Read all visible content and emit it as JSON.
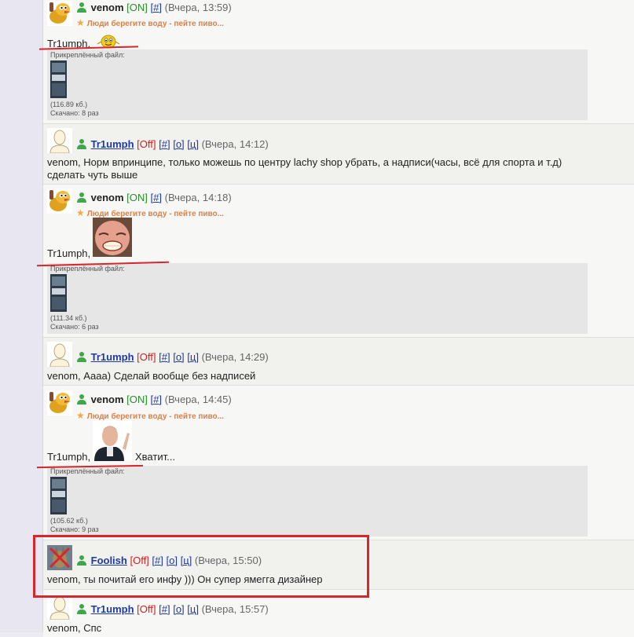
{
  "posts": [
    {
      "user": "venom",
      "status": "[ON]",
      "links": [
        "[#]"
      ],
      "date": "(Вчера, 13:59)",
      "signature": "Люди берегите воду - пейте пиво...",
      "message": "Tr1umph,",
      "attachment": {
        "label": "Прикреплённый файл:",
        "size": "(116.89 кб.)",
        "downloads": "Скачано: 8 раз"
      }
    },
    {
      "user": "Tr1umph",
      "status": "[Off]",
      "links": [
        "[#]",
        "[о]",
        "[ц]"
      ],
      "date": "(Вчера, 14:12)",
      "message_line1": "venom, Норм впринципе, только можешь по центру lachy shop убрать, а надписи(часы, всё для спорта и т.д)",
      "message_line2": "сделать чуть выше"
    },
    {
      "user": "venom",
      "status": "[ON]",
      "links": [
        "[#]"
      ],
      "date": "(Вчера, 14:18)",
      "signature": "Люди берегите воду - пейте пиво...",
      "message": "Tr1umph,",
      "attachment": {
        "label": "Прикреплённый файл:",
        "size": "(111.34 кб.)",
        "downloads": "Скачано: 6 раз"
      }
    },
    {
      "user": "Tr1umph",
      "status": "[Off]",
      "links": [
        "[#]",
        "[о]",
        "[ц]"
      ],
      "date": "(Вчера, 14:29)",
      "message": "venom, Аааа) Сделай вообще без надписей"
    },
    {
      "user": "venom",
      "status": "[ON]",
      "links": [
        "[#]"
      ],
      "date": "(Вчера, 14:45)",
      "signature": "Люди берегите воду - пейте пиво...",
      "message": "Tr1umph,",
      "message_after": "Хватит...",
      "attachment": {
        "label": "Прикреплённый файл:",
        "size": "(105.62 кб.)",
        "downloads": "Скачано: 9 раз"
      }
    },
    {
      "user": "Foolish",
      "status": "[Off]",
      "links": [
        "[#]",
        "[о]",
        "[ц]"
      ],
      "date": "(Вчера, 15:50)",
      "message": "venom, ты почитай его инфу ))) Он супер ямегга дизайнер"
    },
    {
      "user": "Tr1umph",
      "status": "[Off]",
      "links": [
        "[#]",
        "[о]",
        "[ц]"
      ],
      "date": "(Вчера, 15:57)",
      "message": "venom, Спс"
    }
  ],
  "colors": {
    "annotation": "#d7262c",
    "online": "#2c8c2c",
    "offline": "#d02020",
    "link": "#1f3aa0"
  }
}
